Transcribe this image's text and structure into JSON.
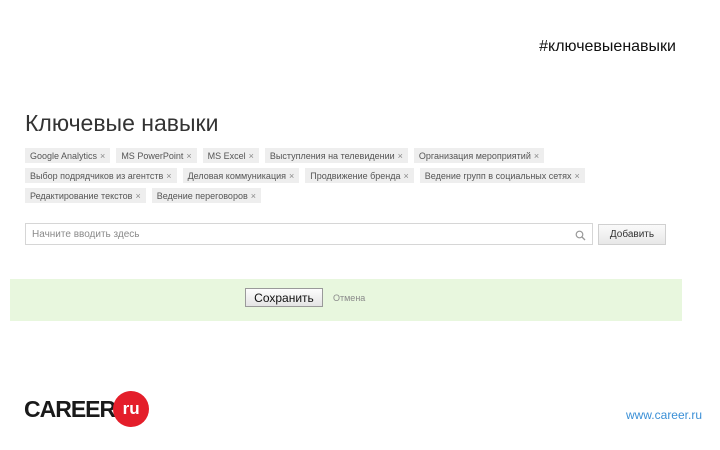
{
  "hashtag": "#ключевыенавыки",
  "title": "Ключевые навыки",
  "tags": [
    [
      "Google Analytics",
      "MS PowerPoint",
      "MS Excel",
      "Выступления на телевидении",
      "Организация мероприятий"
    ],
    [
      "Выбор подрядчиков из агентств",
      "Деловая коммуникация",
      "Продвижение бренда",
      "Ведение групп в социальных сетях"
    ],
    [
      "Редактирование текстов",
      "Ведение переговоров"
    ]
  ],
  "tag_remove_glyph": "×",
  "search": {
    "placeholder": "Начните вводить здесь",
    "value": ""
  },
  "add_button": "Добавить",
  "save_button": "Сохранить",
  "cancel_link": "Отмена",
  "logo": {
    "word": "CAREER",
    "badge": "ru"
  },
  "site_url": "www.career.ru",
  "colors": {
    "band": "#e8f7de",
    "logo_red": "#e41e2a",
    "url_blue": "#3a8fd6"
  }
}
